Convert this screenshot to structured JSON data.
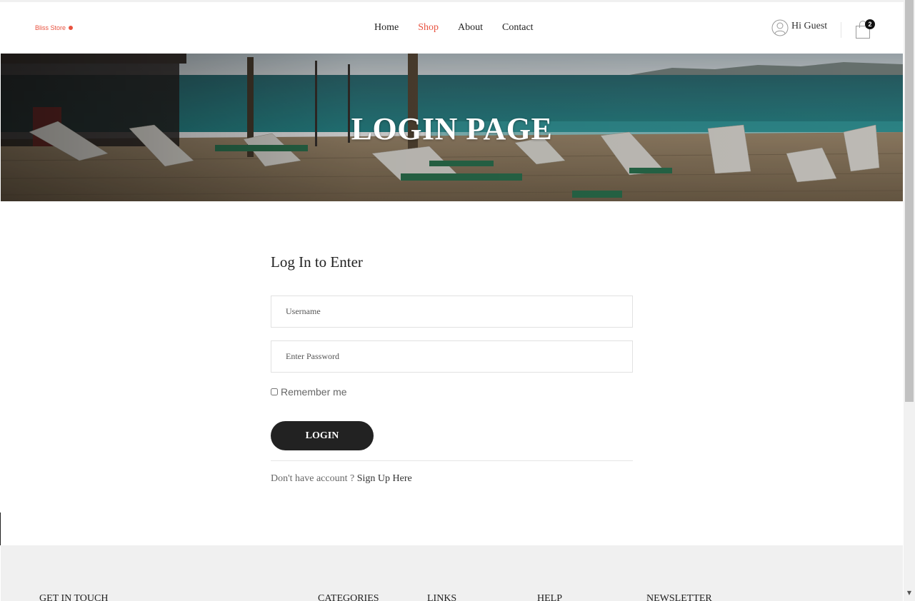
{
  "brand": {
    "name": "Bliss Store",
    "color": "#e8523f"
  },
  "nav": {
    "items": [
      {
        "label": "Home",
        "active": false
      },
      {
        "label": "Shop",
        "active": true
      },
      {
        "label": "About",
        "active": false
      },
      {
        "label": "Contact",
        "active": false
      }
    ]
  },
  "user": {
    "greeting": "Hi Guest",
    "icon": "user-circle-icon"
  },
  "cart": {
    "count": "2",
    "icon": "shopping-bag-icon"
  },
  "hero": {
    "title": "LOGIN PAGE"
  },
  "login_form": {
    "heading": "Log In to Enter",
    "username_placeholder": "Username",
    "username_value": "",
    "password_placeholder": "Enter Password",
    "password_value": "",
    "remember_label": "Remember me",
    "remember_checked": false,
    "submit_label": "LOGIN",
    "signup_prompt": "Don't have account ? ",
    "signup_link": "Sign Up Here"
  },
  "footer": {
    "columns": [
      {
        "title": "GET IN TOUCH"
      },
      {
        "title": "CATEGORIES"
      },
      {
        "title": "LINKS"
      },
      {
        "title": "HELP"
      },
      {
        "title": "NEWSLETTER"
      }
    ]
  }
}
